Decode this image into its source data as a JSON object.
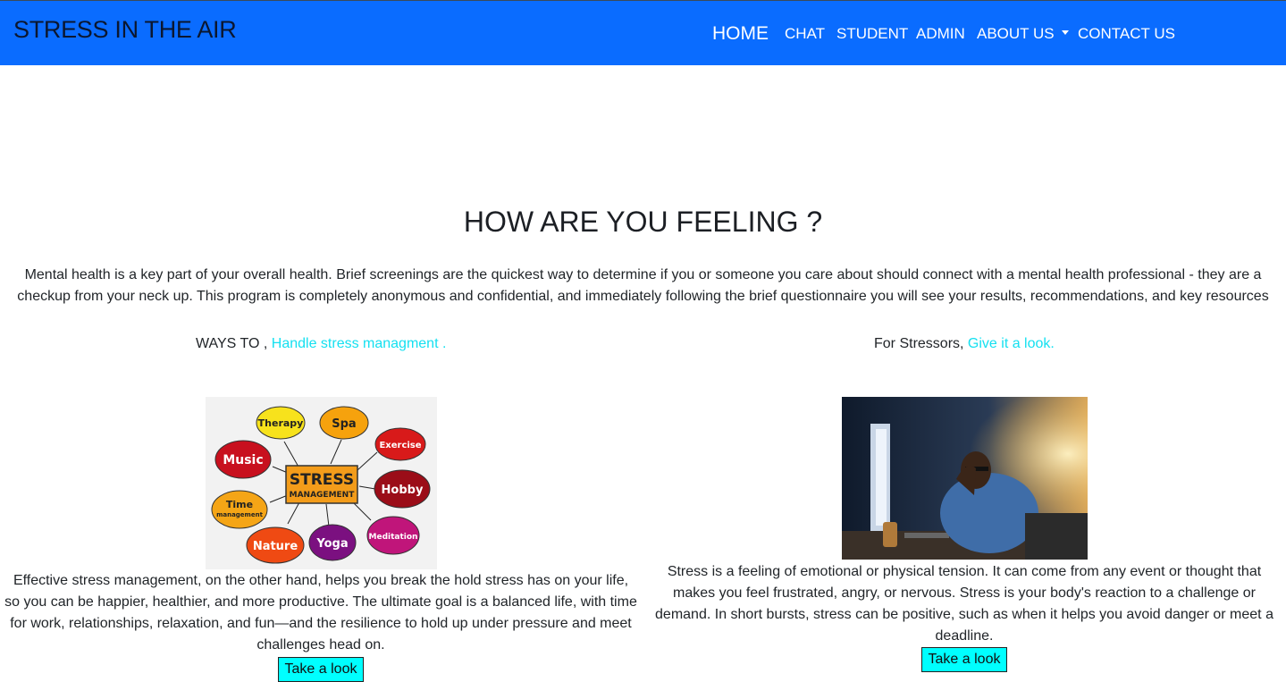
{
  "navbar": {
    "brand": "STRESS IN THE AIR",
    "items": [
      {
        "label": "HOME"
      },
      {
        "label": "CHAT"
      },
      {
        "label": "STUDENT"
      },
      {
        "label": "ADMIN"
      },
      {
        "label": "ABOUT US"
      },
      {
        "label": "CONTACT US"
      }
    ]
  },
  "main": {
    "heading": "HOW ARE YOU FEELING ?",
    "intro_line1": "Mental health is a key part of your overall health. Brief screenings are the quickest way to determine if you or someone you care about should connect with a mental health professional - they are a",
    "intro_line2": "checkup from your neck up. This program is completely anonymous and confidential, and immediately following the brief questionnaire you will see your results, recommendations, and key resources"
  },
  "left_card": {
    "prefix": "WAYS TO ,",
    "link": "Handle stress managment .",
    "image_words": {
      "center_title": "STRESS",
      "center_sub": "MANAGEMENT",
      "bubbles": [
        "Therapy",
        "Spa",
        "Exercise",
        "Music",
        "Hobby",
        "Time",
        "management",
        "Nature",
        "Yoga",
        "Meditation"
      ]
    },
    "text": "Effective stress management, on the other hand, helps you break the hold stress has on your life, so you can be happier, healthier, and more productive. The ultimate goal is a balanced life, with time for work, relationships, relaxation, and fun—and the resilience to hold up under pressure and meet challenges head on.",
    "button": "Take a look"
  },
  "right_card": {
    "prefix": "For Stressors,",
    "link": "Give it a look.",
    "text": "Stress is a feeling of emotional or physical tension. It can come from any event or thought that makes you feel frustrated, angry, or nervous. Stress is your body's reaction to a challenge or demand. In short bursts, stress can be positive, such as when it helps you avoid danger or meet a deadline.",
    "button": "Take a look"
  }
}
